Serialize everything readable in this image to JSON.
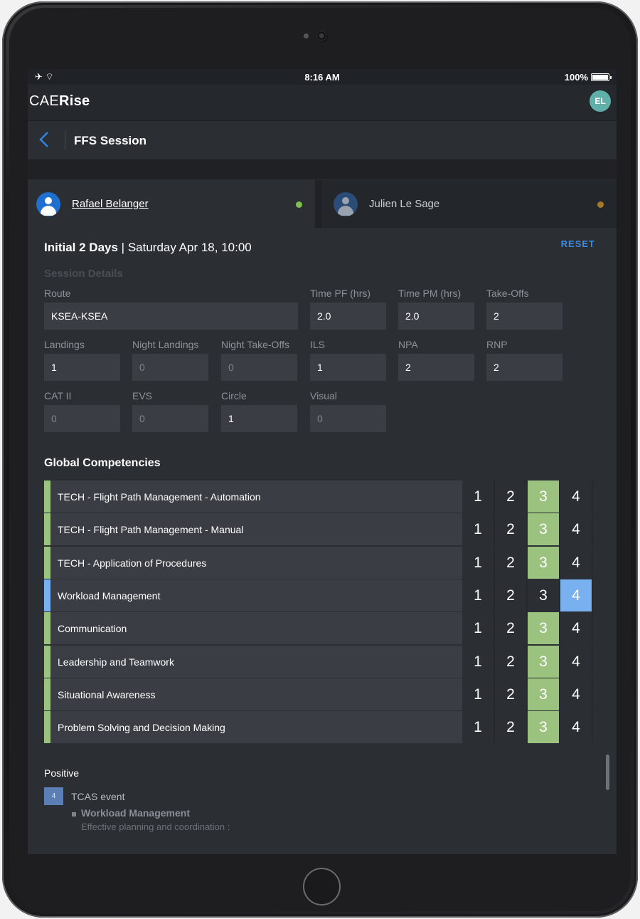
{
  "status_bar": {
    "time": "8:16 AM",
    "battery": "100%"
  },
  "app": {
    "logo_prefix": "CAE",
    "logo_suffix": "Rise",
    "user_initials": "EL"
  },
  "nav": {
    "title": "FFS Session"
  },
  "tabs": [
    {
      "name": "Rafael Belanger",
      "status_color": "#7fbf52",
      "active": true
    },
    {
      "name": "Julien Le Sage",
      "status_color": "#a6792a",
      "active": false
    }
  ],
  "session": {
    "title_bold": "Initial 2 Days",
    "separator": "|",
    "date": "Saturday Apr 18, 10:00",
    "reset_label": "RESET",
    "details_label": "Session Details"
  },
  "fields": {
    "route": {
      "label": "Route",
      "value": "KSEA-KSEA"
    },
    "time_pf": {
      "label": "Time PF (hrs)",
      "value": "2.0"
    },
    "time_pm": {
      "label": "Time PM (hrs)",
      "value": "2.0"
    },
    "takeoffs": {
      "label": "Take-Offs",
      "value": "2"
    },
    "landings": {
      "label": "Landings",
      "value": "1"
    },
    "night_landings": {
      "label": "Night Landings",
      "value": "0"
    },
    "night_takeoffs": {
      "label": "Night Take-Offs",
      "value": "0"
    },
    "ils": {
      "label": "ILS",
      "value": "1"
    },
    "npa": {
      "label": "NPA",
      "value": "2"
    },
    "rnp": {
      "label": "RNP",
      "value": "2"
    },
    "cat2": {
      "label": "CAT II",
      "value": "0"
    },
    "evs": {
      "label": "EVS",
      "value": "0"
    },
    "circle": {
      "label": "Circle",
      "value": "1"
    },
    "visual": {
      "label": "Visual",
      "value": "0"
    }
  },
  "competencies": {
    "title": "Global Competencies",
    "scale": [
      "1",
      "2",
      "3",
      "4"
    ],
    "colors": {
      "green": "#9bc27f",
      "blue": "#78b0f0",
      "bar_green": "#9bc27f",
      "bar_blue": "#78b0f0"
    },
    "items": [
      {
        "label": "TECH - Flight Path Management - Automation",
        "score": 3
      },
      {
        "label": "TECH - Flight Path Management - Manual",
        "score": 3
      },
      {
        "label": "TECH - Application of Procedures",
        "score": 3
      },
      {
        "label": "Workload Management",
        "score": 4
      },
      {
        "label": "Communication",
        "score": 3
      },
      {
        "label": "Leadership and Teamwork",
        "score": 3
      },
      {
        "label": "Situational Awareness",
        "score": 3
      },
      {
        "label": "Problem Solving and Decision Making",
        "score": 3
      }
    ]
  },
  "positive": {
    "title": "Positive",
    "badge": "4",
    "event": "TCAS event",
    "competency": "Workload Management",
    "description": "Effective planning and coordination :"
  }
}
